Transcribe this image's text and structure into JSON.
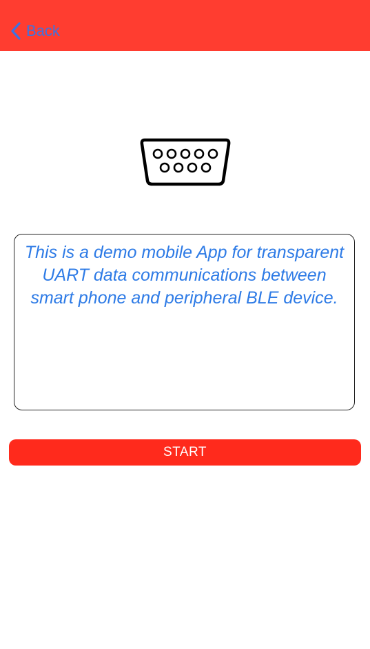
{
  "navbar": {
    "back_label": "Back",
    "back_icon": "chevron-left-icon",
    "background_color": "#FF3D30",
    "back_color": "#3F72E0"
  },
  "main": {
    "icon": "serial-port-icon",
    "description": "This is a demo mobile App for transparent UART data communications between smart phone and peripheral BLE device.",
    "description_color": "#2E7BE6",
    "start_label": "START",
    "start_color": "#FF2A1C"
  }
}
